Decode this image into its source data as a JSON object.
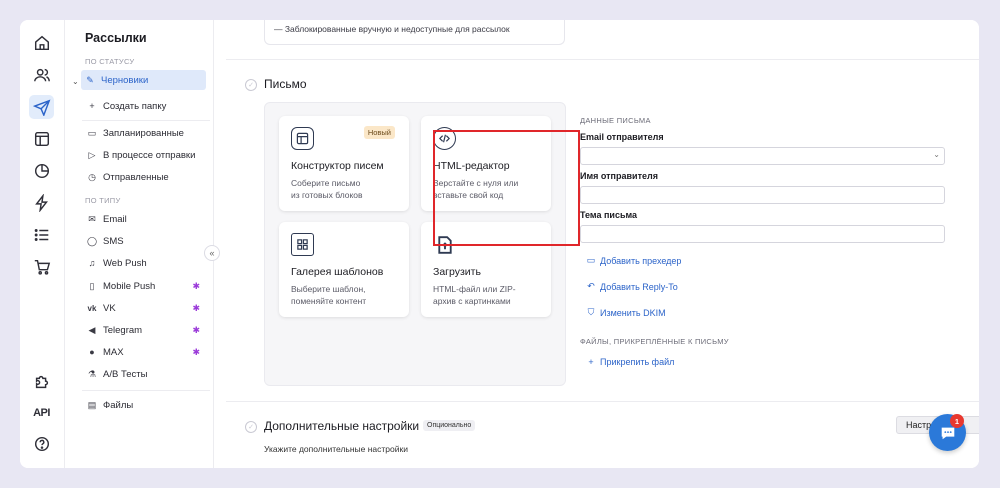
{
  "rail": {
    "api_label": "API"
  },
  "sidebar": {
    "title": "Рассылки",
    "status_section": "ПО СТАТУСУ",
    "status_items": [
      {
        "label": "Черновики",
        "icon": "pencil-icon"
      },
      {
        "label": "Создать папку",
        "icon": "plus-icon"
      },
      {
        "label": "Запланированные",
        "icon": "calendar-icon"
      },
      {
        "label": "В процессе отправки",
        "icon": "send-icon"
      },
      {
        "label": "Отправленные",
        "icon": "clock-icon"
      }
    ],
    "type_section": "ПО ТИПУ",
    "type_items": [
      {
        "label": "Email",
        "icon": "mail-icon"
      },
      {
        "label": "SMS",
        "icon": "chat-bubble-icon"
      },
      {
        "label": "Web Push",
        "icon": "bell-icon"
      },
      {
        "label": "Mobile Push",
        "icon": "phone-icon"
      },
      {
        "label": "VK",
        "icon": "vk-icon"
      },
      {
        "label": "Telegram",
        "icon": "telegram-icon"
      },
      {
        "label": "MAX",
        "icon": "max-icon"
      },
      {
        "label": "A/B Тесты",
        "icon": "ab-test-icon"
      },
      {
        "label": "Файлы",
        "icon": "files-icon"
      }
    ],
    "collapse_label": "«"
  },
  "main": {
    "top_card_text": "— Заблокированные вручную и недоступные для рассылок",
    "letter_title": "Письмо",
    "cards": [
      {
        "title": "Конструктор писем",
        "desc": "Соберите письмо\nиз готовых блоков",
        "badge": "Новый",
        "icon": "layout-icon"
      },
      {
        "title": "HTML-редактор",
        "desc": "Верстайте с нуля или\nвставьте свой код",
        "icon": "code-icon"
      },
      {
        "title": "Галерея шаблонов",
        "desc": "Выберите шаблон,\nпоменяйте контент",
        "icon": "gallery-icon"
      },
      {
        "title": "Загрузить",
        "desc": "HTML-файл или ZIP-\nархив с картинками",
        "icon": "upload-file-icon"
      }
    ],
    "form": {
      "section_data": "ДАННЫЕ ПИСЬМА",
      "sender_email_label": "Email отправителя",
      "sender_email_value": "",
      "sender_name_label": "Имя отправителя",
      "sender_name_value": "",
      "subject_label": "Тема письма",
      "subject_value": "",
      "link_preheader": "Добавить прехедер",
      "link_reply_to": "Добавить Reply-To",
      "link_dkim": "Изменить DKIM",
      "section_files": "ФАЙЛЫ, ПРИКРЕПЛЁННЫЕ К ПИСЬМУ",
      "link_attach": "Прикрепить файл"
    },
    "extra": {
      "title": "Дополнительные настройки",
      "badge": "Опционально",
      "desc": "Укажите дополнительные настройки",
      "button": "Настр"
    }
  },
  "chat": {
    "badge_count": "1"
  },
  "colors": {
    "accent": "#2c64c9",
    "highlight": "#e0262a",
    "chat": "#2b79d9",
    "badge_new": "#fbe7c8"
  }
}
